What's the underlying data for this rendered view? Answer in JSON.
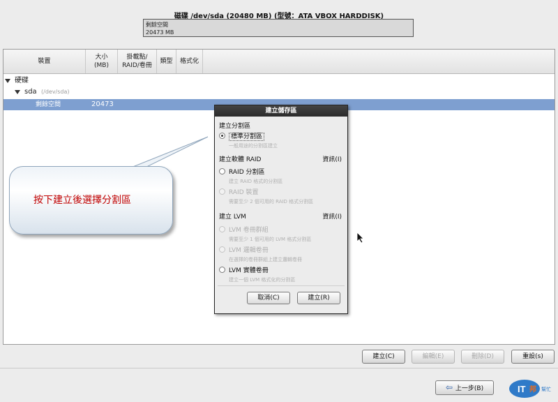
{
  "disk": {
    "title": "磁碟 /dev/sda (20480 MB) (型號：ATA VBOX HARDDISK)",
    "free_label": "剩餘空間",
    "free_size": "20473 MB"
  },
  "table": {
    "headers": {
      "device": "裝置",
      "size": "大小",
      "size_unit": "(MB)",
      "mount": "掛載點/",
      "mount2": "RAID/卷冊",
      "type": "類型",
      "format": "格式化"
    },
    "rows": {
      "group": "硬碟",
      "disk_name": "sda",
      "disk_path": "(/dev/sda)",
      "free_label": "剩餘空間",
      "free_size": "20473"
    }
  },
  "callout": {
    "text": "按下建立後選擇分割區"
  },
  "dialog": {
    "title": "建立儲存區",
    "section_partition": "建立分割區",
    "std_partition": "標準分割區",
    "std_partition_desc": "一般用途的分割區建立",
    "section_raid": "建立軟體 RAID",
    "info_raid": "資訊(I)",
    "raid_partition": "RAID 分割區",
    "raid_partition_desc": "建立 RAID 格式的分割區",
    "raid_device": "RAID 裝置",
    "raid_device_desc": "需要至少 2 個可用的 RAID 格式分割區",
    "section_lvm": "建立 LVM",
    "info_lvm": "資訊(I)",
    "lvm_group": "LVM 卷冊群組",
    "lvm_group_desc": "需要至少 1 個可用的 LVM 格式分割區",
    "lvm_logical": "LVM 邏輯卷冊",
    "lvm_logical_desc": "在選擇的卷冊群組上建立邏輯卷冊",
    "lvm_physical": "LVM 實體卷冊",
    "lvm_physical_desc": "建立一個 LVM 格式化的分割區",
    "cancel": "取消(C)",
    "create": "建立(R)"
  },
  "actions": {
    "create": "建立(C)",
    "edit": "編輯(E)",
    "delete": "刪除(D)",
    "reset": "重設(s)",
    "back": "上一步(B)"
  },
  "watermark": {
    "text": "IT邦幫忙"
  },
  "colors": {
    "selected_row": "#7e9fd0",
    "callout_text": "#c00000",
    "dialog_title_bg": "#2b2b2b"
  }
}
